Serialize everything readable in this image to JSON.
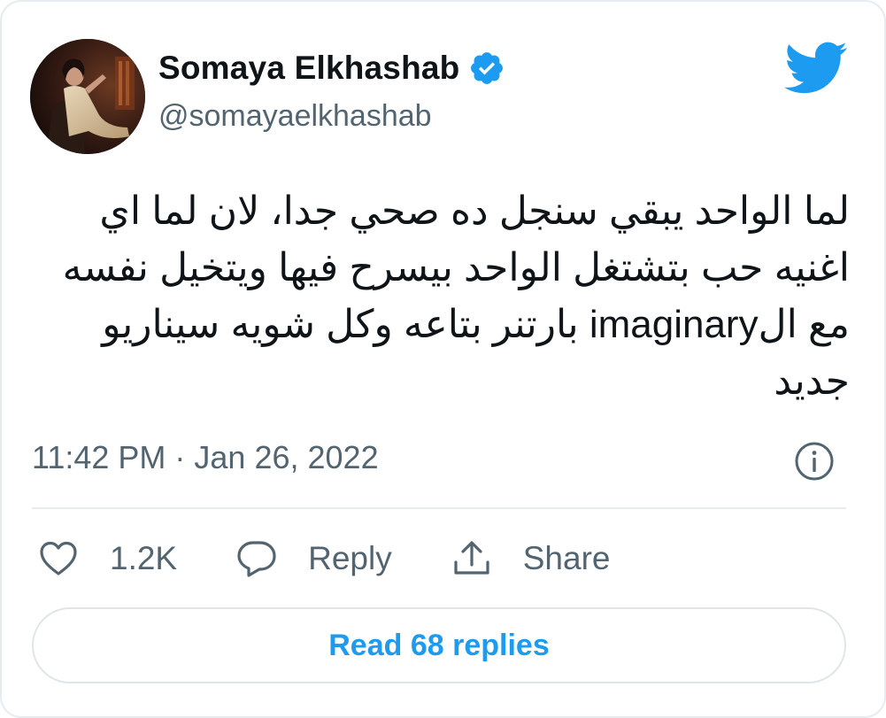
{
  "author": {
    "display_name": "Somaya Elkhashab",
    "handle": "@somayaelkhashab",
    "verified": true
  },
  "tweet": {
    "text": "لما الواحد يبقي سنجل ده صحي جدا، لان لما اي اغنيه حب بتشتغل الواحد بيسرح فيها ويتخيل نفسه مع الimaginary بارتنر بتاعه وكل شويه سيناريو جديد",
    "timestamp": "11:42 PM · Jan 26, 2022"
  },
  "actions": {
    "like_count": "1.2K",
    "reply_label": "Reply",
    "share_label": "Share"
  },
  "read_replies_label": "Read 68 replies",
  "icons": {
    "avatar": "profile-photo",
    "verified": "verified-badge-icon",
    "brand": "twitter-bird-icon",
    "info": "info-icon",
    "like": "heart-icon",
    "reply": "speech-bubble-icon",
    "share": "share-upload-icon"
  },
  "colors": {
    "accent": "#1d9bf0",
    "text_primary": "#0f1419",
    "text_secondary": "#536471",
    "border": "#e6ecf0"
  }
}
